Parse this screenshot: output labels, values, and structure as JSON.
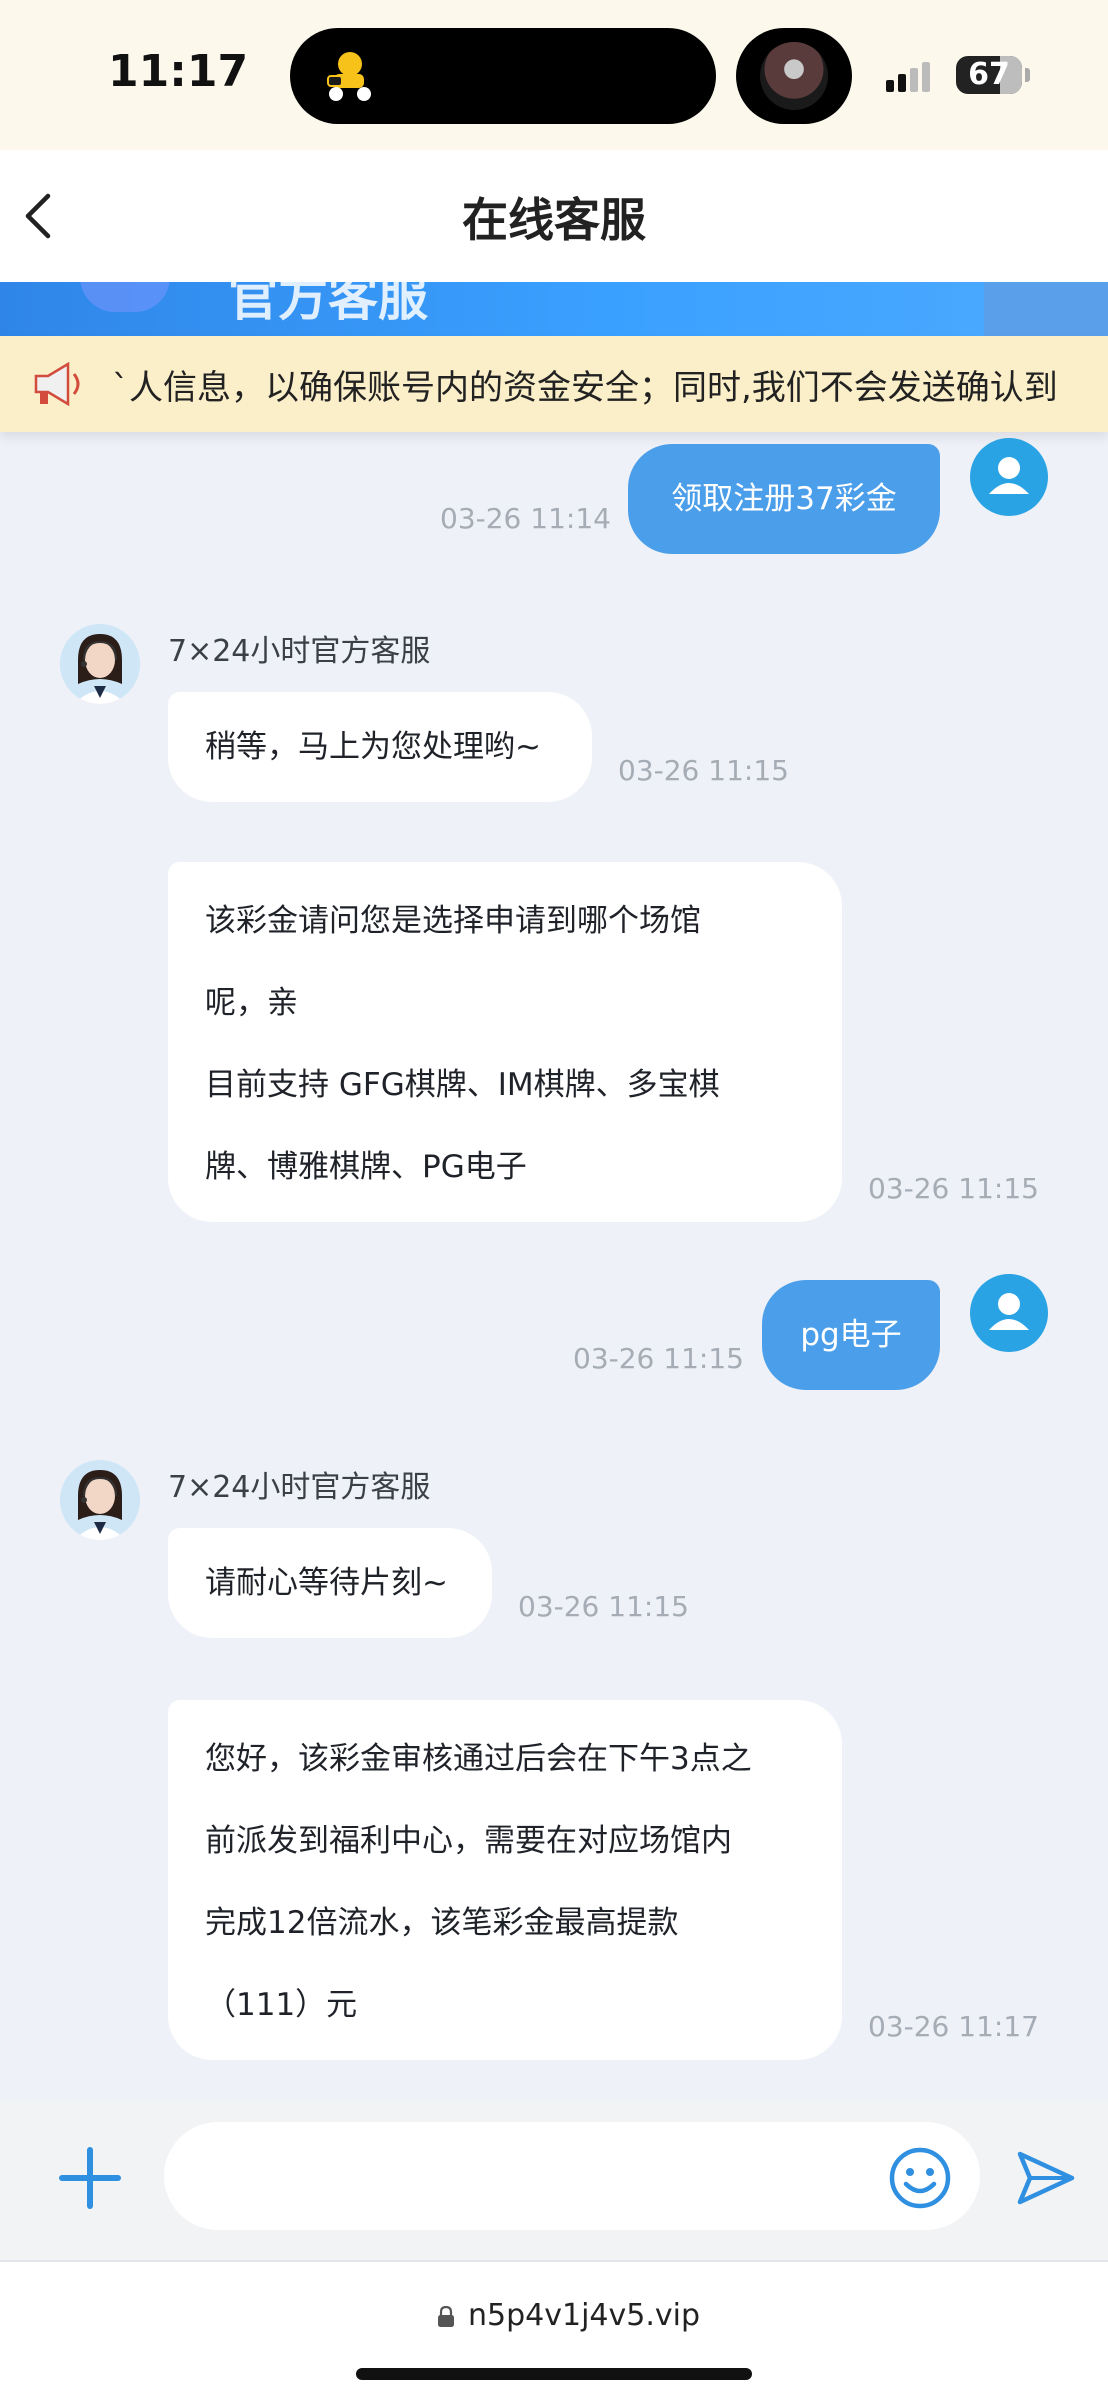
{
  "status_bar": {
    "time": "11:17",
    "battery": "67"
  },
  "header": {
    "title": "在线客服"
  },
  "notice": {
    "text": "`人信息，以确保账号内的资金安全；同时,我们不会发送确认到"
  },
  "banner": {
    "text": "官方客服"
  },
  "agent": {
    "name": "7×24小时官方客服"
  },
  "messages": {
    "m1": {
      "text": "领取注册37彩金",
      "time": "03-26 11:14"
    },
    "m2": {
      "text": "稍等，马上为您处理哟~",
      "time": "03-26 11:15"
    },
    "m3": {
      "lines": [
        "该彩金请问您是选择申请到哪个场馆",
        "呢，亲",
        "目前支持 GFG棋牌、IM棋牌、多宝棋",
        "牌、博雅棋牌、PG电子"
      ],
      "time": "03-26 11:15"
    },
    "m4": {
      "text": "pg电子",
      "time": "03-26 11:15"
    },
    "m5": {
      "text": "请耐心等待片刻~",
      "time": "03-26 11:15"
    },
    "m6": {
      "lines": [
        "您好，该彩金审核通过后会在下午3点之",
        "前派发到福利中心，需要在对应场馆内",
        "完成12倍流水，该笔彩金最高提款",
        "（111）元"
      ],
      "time": "03-26 11:17"
    }
  },
  "input": {
    "placeholder": ""
  },
  "browser": {
    "url": "n5p4v1j4v5.vip"
  },
  "icons": {
    "user_avatar": "user-avatar-icon",
    "agent_avatar": "agent-avatar",
    "plus": "plus-icon",
    "emoji": "emoji-icon",
    "send": "send-icon",
    "back": "back-icon",
    "megaphone": "megaphone-icon",
    "lock": "lock-icon"
  },
  "colors": {
    "user_bubble": "#4b9ee9",
    "agent_bubble": "#ffffff",
    "accent": "#29a3e3",
    "notice_bg": "#fbefc9"
  }
}
